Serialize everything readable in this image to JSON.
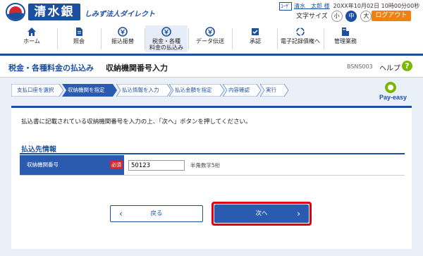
{
  "header": {
    "bank_name": "清水銀行",
    "service_name": "しみず法人ダイレクト",
    "user_badge": "ﾕｰｻﾞ",
    "user_name": "清水　太郎 様",
    "datetime": "20XX年10月02日 10時00分00秒",
    "font_size_label": "文字サイズ",
    "font_sizes": [
      "小",
      "中",
      "大"
    ],
    "font_size_selected": "中",
    "logout_label": "ログアウト"
  },
  "nav": {
    "items": [
      {
        "label": "ホーム",
        "icon": "home-icon"
      },
      {
        "label": "照会",
        "icon": "document-icon"
      },
      {
        "label": "振込振替",
        "icon": "transfer-icon"
      },
      {
        "label": "税金・各種\n料金の払込み",
        "icon": "yen-icon",
        "active": true
      },
      {
        "label": "データ伝送",
        "icon": "data-transfer-icon"
      },
      {
        "label": "承認",
        "icon": "approval-icon"
      },
      {
        "label": "電子記録債権へ",
        "icon": "sync-icon"
      },
      {
        "label": "管理業務",
        "icon": "admin-icon"
      }
    ]
  },
  "title": {
    "category": "税金・各種料金の払込み",
    "page": "収納機関番号入力",
    "screen_id": "BSNS003",
    "help_label": "ヘルプ",
    "help_icon": "?"
  },
  "steps": [
    "支払口座を選択",
    "収納機関を指定",
    "払込情報を入力",
    "払込金額を指定",
    "内容確認",
    "実行"
  ],
  "steps_active_index": 1,
  "payeasy_logo": "Pay-easy",
  "panel": {
    "message": "払込書に記載されている収納機関番号を入力の上、「次へ」ボタンを押してください。",
    "section_title": "払込先情報",
    "field_label": "収納機関番号",
    "required_label": "必須",
    "field_value": "50123",
    "field_note": "半角数字5桁"
  },
  "buttons": {
    "back_label": "戻る",
    "next_label": "次へ"
  },
  "colors": {
    "primary": "#1d4fa0",
    "accent": "#f08010",
    "highlight": "#e00010",
    "required": "#d8262c",
    "background": "#eaf0f8"
  }
}
